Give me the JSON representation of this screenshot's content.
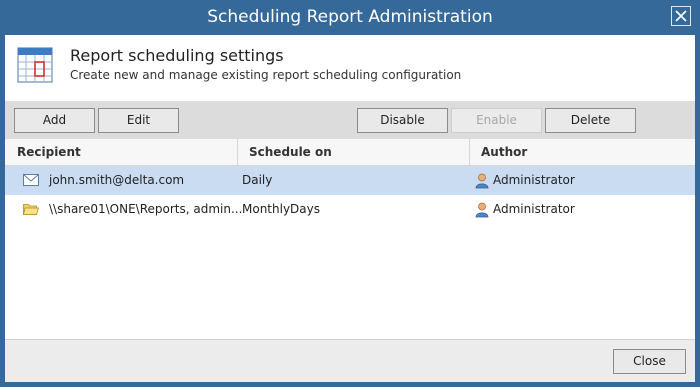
{
  "window": {
    "title": "Scheduling Report Administration"
  },
  "header": {
    "title": "Report scheduling settings",
    "subtitle": "Create new and manage existing report scheduling configuration"
  },
  "toolbar": {
    "add_label": "Add",
    "edit_label": "Edit",
    "disable_label": "Disable",
    "enable_label": "Enable",
    "delete_label": "Delete"
  },
  "table": {
    "columns": [
      "Recipient",
      "Schedule on",
      "Author"
    ],
    "rows": [
      {
        "recipient": "john.smith@delta.com",
        "recipient_icon": "envelope-icon",
        "schedule": "Daily",
        "author": "Administrator",
        "author_icon": "user-icon",
        "selected": true
      },
      {
        "recipient": "\\\\share01\\ONE\\Reports, admin...",
        "recipient_icon": "folder-icon",
        "schedule": "MonthlyDays",
        "author": "Administrator",
        "author_icon": "user-icon",
        "selected": false
      }
    ]
  },
  "footer": {
    "close_label": "Close"
  },
  "colors": {
    "titlebar": "#35699a",
    "selected_row": "#c9dcf1",
    "toolbar": "#dcdcdc"
  }
}
